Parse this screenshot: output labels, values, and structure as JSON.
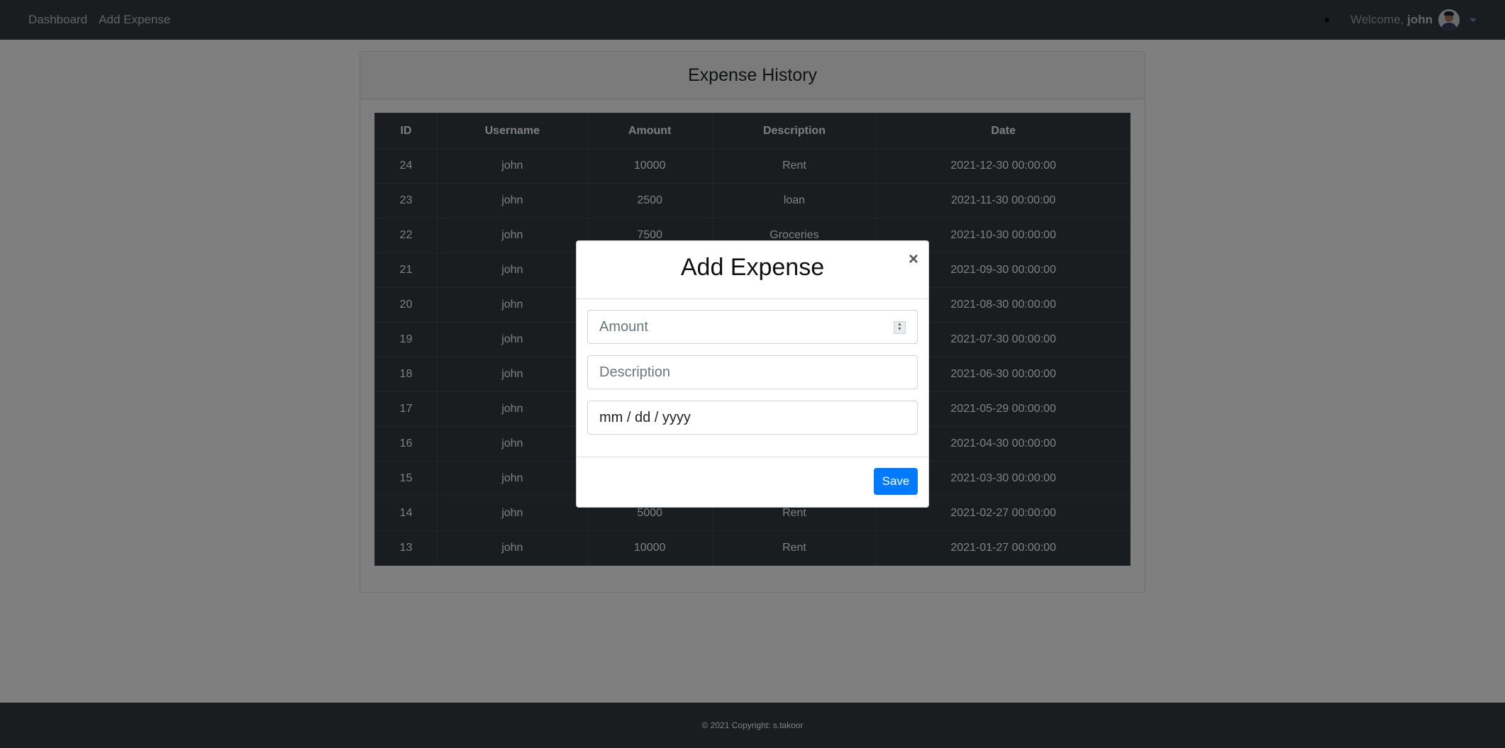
{
  "navbar": {
    "links": [
      "Dashboard",
      "Add Expense"
    ],
    "welcome_prefix": "Welcome,",
    "username": "john"
  },
  "card": {
    "title": "Expense History"
  },
  "table": {
    "headers": [
      "ID",
      "Username",
      "Amount",
      "Description",
      "Date"
    ],
    "rows": [
      [
        "24",
        "john",
        "10000",
        "Rent",
        "2021-12-30 00:00:00"
      ],
      [
        "23",
        "john",
        "2500",
        "loan",
        "2021-11-30 00:00:00"
      ],
      [
        "22",
        "john",
        "7500",
        "Groceries",
        "2021-10-30 00:00:00"
      ],
      [
        "21",
        "john",
        "",
        "",
        "2021-09-30 00:00:00"
      ],
      [
        "20",
        "john",
        "",
        "",
        "2021-08-30 00:00:00"
      ],
      [
        "19",
        "john",
        "",
        "",
        "2021-07-30 00:00:00"
      ],
      [
        "18",
        "john",
        "",
        "",
        "2021-06-30 00:00:00"
      ],
      [
        "17",
        "john",
        "",
        "",
        "2021-05-29 00:00:00"
      ],
      [
        "16",
        "john",
        "",
        "",
        "2021-04-30 00:00:00"
      ],
      [
        "15",
        "john",
        "",
        "",
        "2021-03-30 00:00:00"
      ],
      [
        "14",
        "john",
        "5000",
        "Rent",
        "2021-02-27 00:00:00"
      ],
      [
        "13",
        "john",
        "10000",
        "Rent",
        "2021-01-27 00:00:00"
      ]
    ]
  },
  "footer": {
    "text": "© 2021 Copyright: s.takoor"
  },
  "modal": {
    "title": "Add Expense",
    "close_label": "×",
    "amount_placeholder": "Amount",
    "description_placeholder": "Description",
    "date_placeholder": "mm / dd / yyyy",
    "save_label": "Save"
  },
  "colors": {
    "navbar": "#343a40",
    "primary": "#007bff",
    "table_dark": "#343a40"
  }
}
